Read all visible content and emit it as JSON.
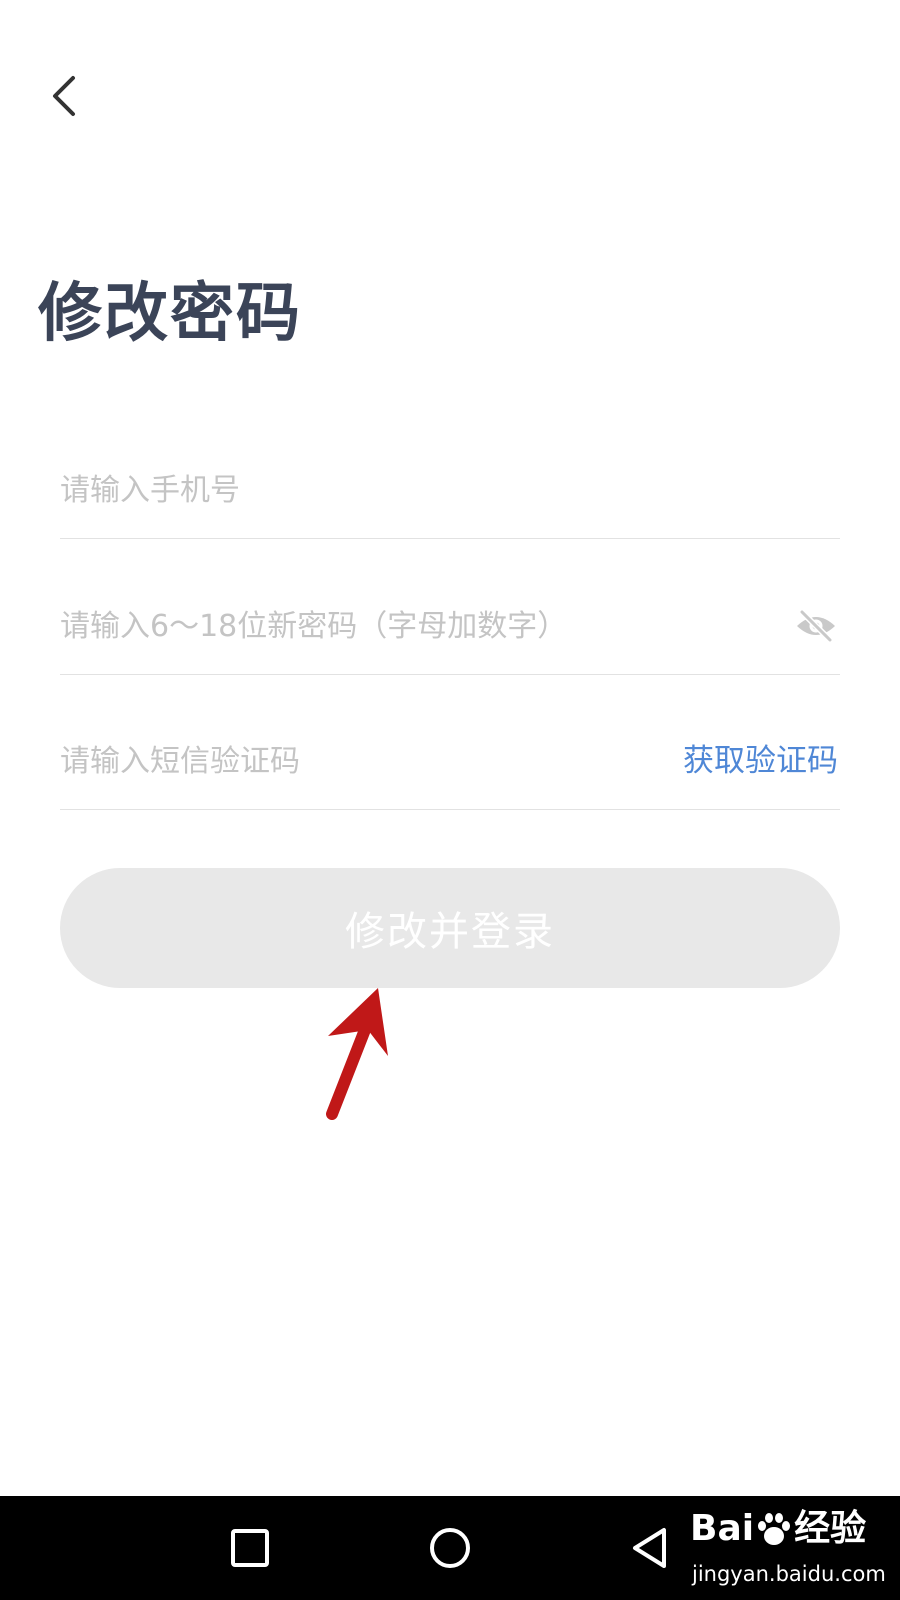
{
  "header": {
    "back_icon": "chevron-left-icon",
    "title": "修改密码"
  },
  "form": {
    "phone": {
      "placeholder": "请输入手机号",
      "value": ""
    },
    "password": {
      "placeholder": "请输入6～18位新密码（字母加数字）",
      "value": "",
      "toggle_icon": "eye-slash-icon"
    },
    "sms_code": {
      "placeholder": "请输入短信验证码",
      "value": "",
      "get_code_label": "获取验证码"
    },
    "submit_label": "修改并登录"
  },
  "colors": {
    "title": "#3b4458",
    "link": "#4f87d6",
    "button_disabled_bg": "#e8e8e8",
    "annotation_arrow": "#c01818"
  },
  "navbar": {
    "icons": [
      "square-recent-apps-icon",
      "circle-home-icon",
      "triangle-back-icon"
    ]
  },
  "watermark": {
    "logo_text_1": "Bai",
    "logo_text_2": "经验",
    "url": "jingyan.baidu.com"
  }
}
